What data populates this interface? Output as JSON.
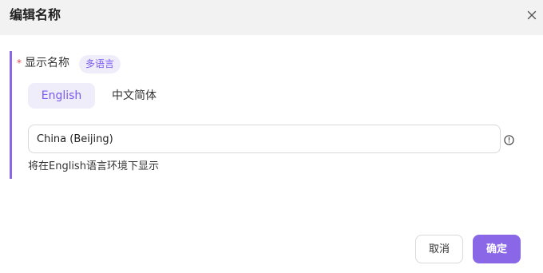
{
  "dialog": {
    "title": "编辑名称",
    "close_icon": "close-icon"
  },
  "field": {
    "required_mark": "*",
    "label": "显示名称",
    "multilang_badge": "多语言"
  },
  "tabs": [
    {
      "label": "English",
      "active": true
    },
    {
      "label": "中文简体",
      "active": false
    }
  ],
  "input": {
    "value": "China (Beijing)",
    "info_icon": "info-circle-icon"
  },
  "helper_text": "将在English语言环境下显示",
  "footer": {
    "cancel_label": "取消",
    "ok_label": "确定"
  },
  "colors": {
    "accent": "#8a67e6",
    "accent_light": "#f0edfb",
    "required": "#e5484d"
  }
}
